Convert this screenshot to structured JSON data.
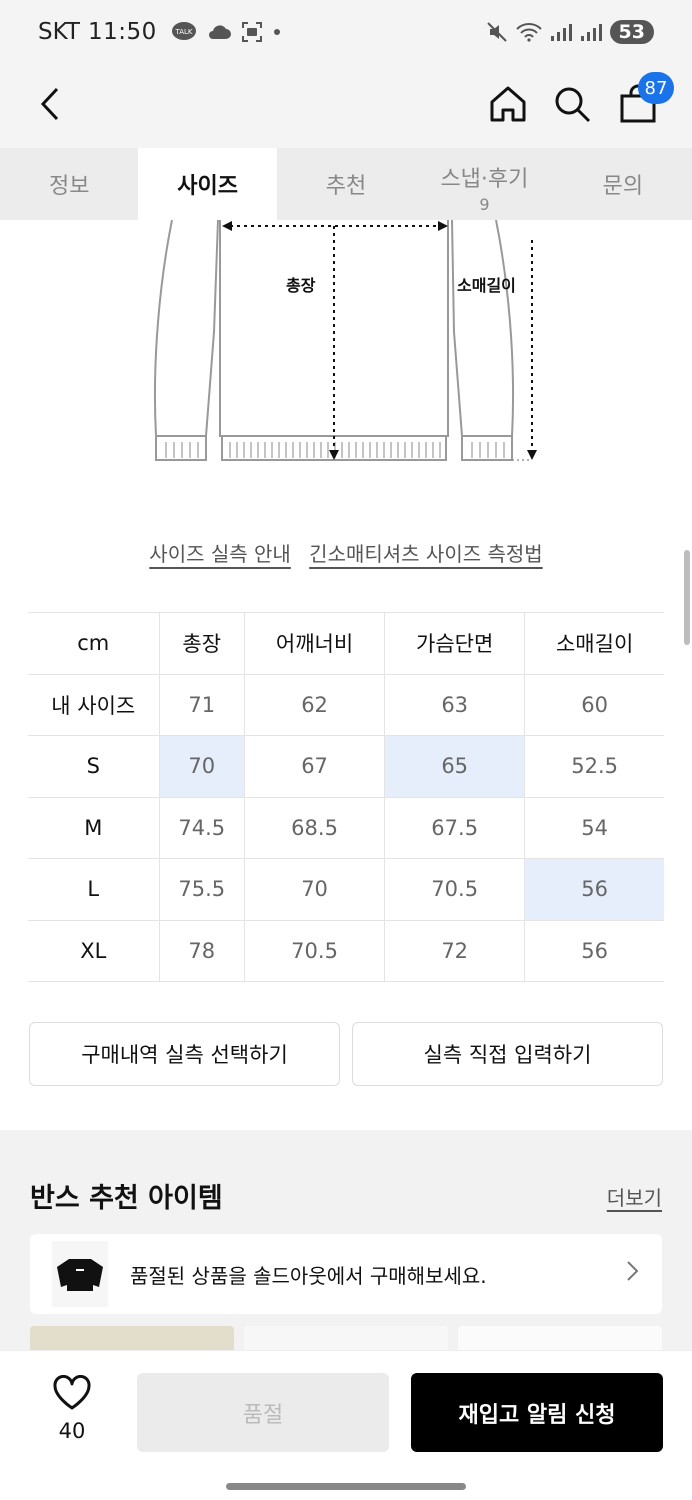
{
  "status_bar": {
    "carrier": "SKT",
    "time": "11:50",
    "battery": "53"
  },
  "header": {
    "cart_count": "87"
  },
  "tabs": [
    {
      "label": "정보",
      "count": ""
    },
    {
      "label": "사이즈",
      "count": ""
    },
    {
      "label": "추천",
      "count": ""
    },
    {
      "label": "스냅·후기",
      "count": "9"
    },
    {
      "label": "문의",
      "count": ""
    }
  ],
  "diagram": {
    "length_label": "총장",
    "sleeve_label": "소매길이"
  },
  "guide_links": {
    "size_guide": "사이즈 실측 안내",
    "measure_method": "긴소매티셔츠 사이즈 측정법"
  },
  "size_table": {
    "headers": [
      "cm",
      "총장",
      "어깨너비",
      "가슴단면",
      "소매길이"
    ],
    "rows": [
      {
        "label": "내 사이즈",
        "values": [
          "71",
          "62",
          "63",
          "60"
        ]
      },
      {
        "label": "S",
        "values": [
          "70",
          "67",
          "65",
          "52.5"
        ]
      },
      {
        "label": "M",
        "values": [
          "74.5",
          "68.5",
          "67.5",
          "54"
        ]
      },
      {
        "label": "L",
        "values": [
          "75.5",
          "70",
          "70.5",
          "56"
        ]
      },
      {
        "label": "XL",
        "values": [
          "78",
          "70.5",
          "72",
          "56"
        ]
      }
    ],
    "highlight_color": "#e6eefc"
  },
  "actions": {
    "select_purchase": "구매내역 실측 선택하기",
    "direct_input": "실측 직접 입력하기"
  },
  "recommend": {
    "title": "반스 추천 아이템",
    "more": "더보기",
    "soldout_banner": "품절된 상품을 솔드아웃에서 구매해보세요."
  },
  "bottom_bar": {
    "like_count": "40",
    "soldout_label": "품절",
    "restock_label": "재입고 알림 신청"
  },
  "colors": {
    "accent_badge": "#1a73e8",
    "primary_button": "#000000"
  }
}
